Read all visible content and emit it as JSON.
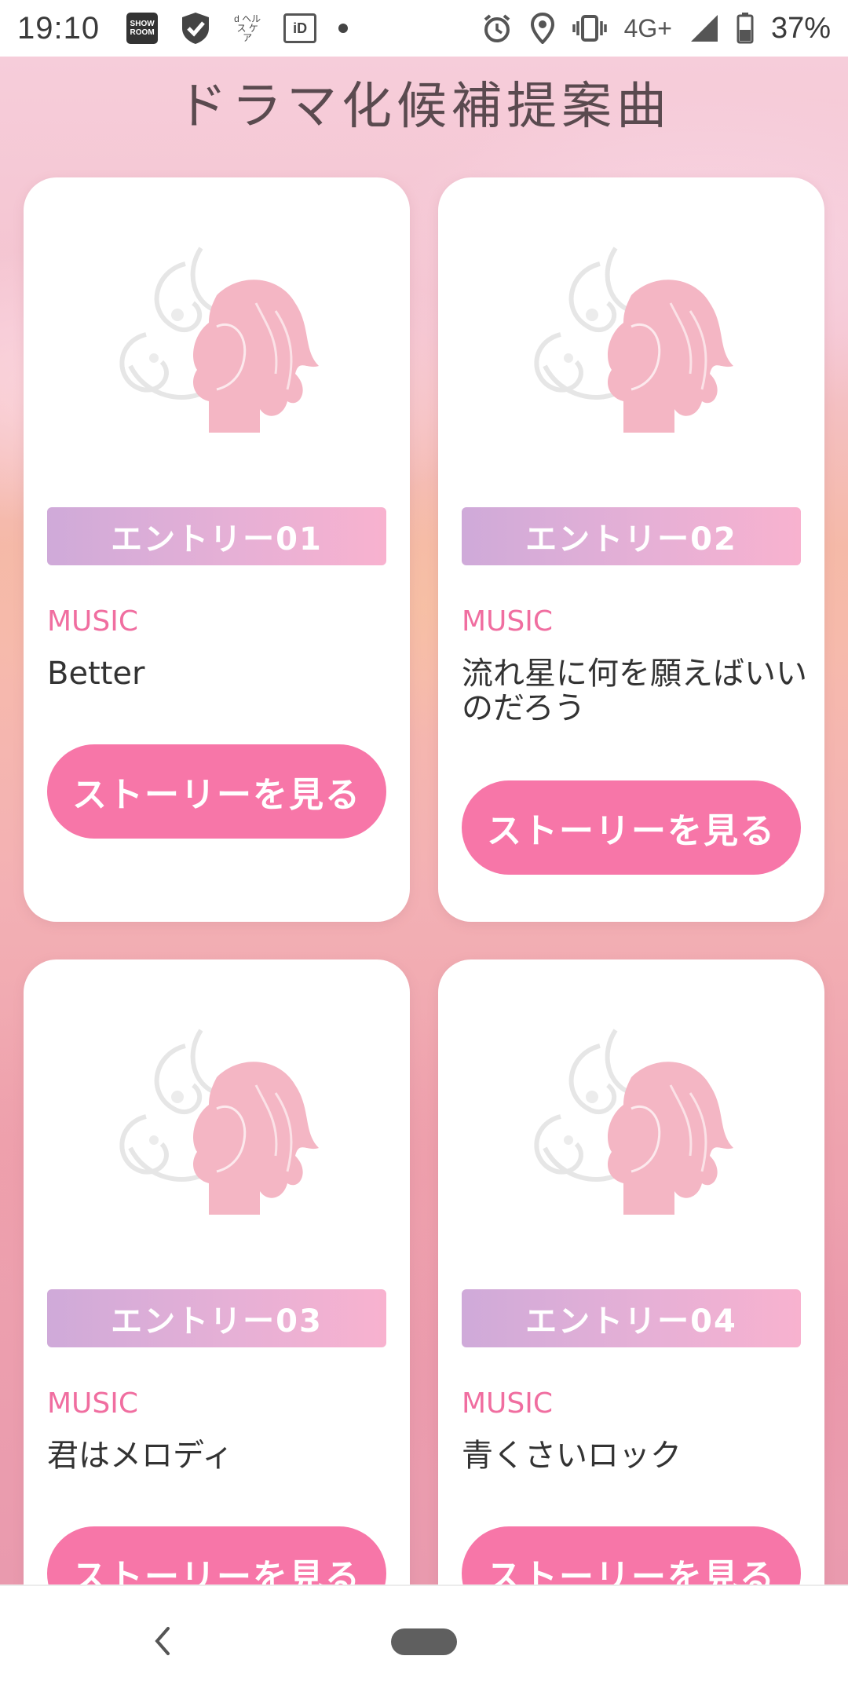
{
  "status_bar": {
    "time": "19:10",
    "showroom_icon_text": "SHOW ROOM",
    "dcare_icon_text": "d ヘルス ケア",
    "id_icon_text": "iD",
    "network": "4G+",
    "battery": "37%"
  },
  "page": {
    "title": "ドラマ化候補提案曲"
  },
  "cards": [
    {
      "entry": "エントリー01",
      "music_label": "MUSIC",
      "song": "Better",
      "button": "ストーリーを見る"
    },
    {
      "entry": "エントリー02",
      "music_label": "MUSIC",
      "song": "流れ星に何を願えばいいのだろう",
      "button": "ストーリーを見る"
    },
    {
      "entry": "エントリー03",
      "music_label": "MUSIC",
      "song": "君はメロディ",
      "button": "ストーリーを見る"
    },
    {
      "entry": "エントリー04",
      "music_label": "MUSIC",
      "song": "青くさいロック",
      "button": "ストーリーを見る"
    }
  ],
  "icons": {
    "card_illustration": "woman-silhouette-icon",
    "nav_back": "back-chevron-icon",
    "nav_home": "home-pill-icon"
  },
  "colors": {
    "accent_pink": "#f776a8",
    "music_label": "#f06ea0",
    "badge_gradient_start": "#cfaad9",
    "badge_gradient_end": "#f8b2cf"
  }
}
